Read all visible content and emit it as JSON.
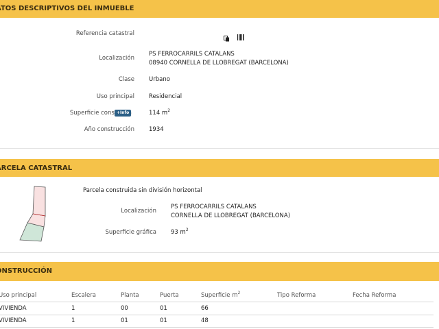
{
  "datos": {
    "title": "ATOS DESCRIPTIVOS DEL INMUEBLE",
    "referencia_label": "Referencia catastral",
    "localizacion_label": "Localización",
    "localizacion_line1": "PS FERROCARRILS CATALANS",
    "localizacion_line2": "08940 CORNELLA DE LLOBREGAT (BARCELONA)",
    "clase_label": "Clase",
    "clase_value": "Urbano",
    "uso_label": "Uso principal",
    "uso_value": "Residencial",
    "superficie_label": "Superficie construida",
    "info_badge": "+Info",
    "superficie_value": "114 m",
    "superficie_exp": "2",
    "anio_label": "Año construcción",
    "anio_value": "1934",
    "icons": [
      "copy-icon",
      "barcode-icon"
    ]
  },
  "parcela": {
    "title": "ARCELA CATASTRAL",
    "descripcion": "Parcela construida sin división horizontal",
    "localizacion_label": "Localización",
    "localizacion_line1": "PS FERROCARRILS CATALANS",
    "localizacion_line2": "CORNELLA DE LLOBREGAT (BARCELONA)",
    "superficie_label": "Superficie gráfica",
    "superficie_value": "93 m",
    "superficie_exp": "2"
  },
  "construccion": {
    "title": "ONSTRUCCIÓN",
    "headers": {
      "uso": "Uso principal",
      "escalera": "Escalera",
      "planta": "Planta",
      "puerta": "Puerta",
      "superficie": "Superficie m",
      "superficie_exp": "2",
      "tipo_reforma": "Tipo Reforma",
      "fecha_reforma": "Fecha Reforma"
    },
    "rows": [
      {
        "uso": "VIVIENDA",
        "escalera": "1",
        "planta": "00",
        "puerta": "01",
        "superficie": "66",
        "tipo_reforma": "",
        "fecha_reforma": ""
      },
      {
        "uso": "VIVIENDA",
        "escalera": "1",
        "planta": "01",
        "puerta": "01",
        "superficie": "48",
        "tipo_reforma": "",
        "fecha_reforma": ""
      }
    ]
  },
  "colors": {
    "band": "#f5c249",
    "badge": "#2b5f86",
    "plot_pink": "#f9e1e1",
    "plot_green": "#cfe6d8",
    "plot_outline": "#555555"
  }
}
